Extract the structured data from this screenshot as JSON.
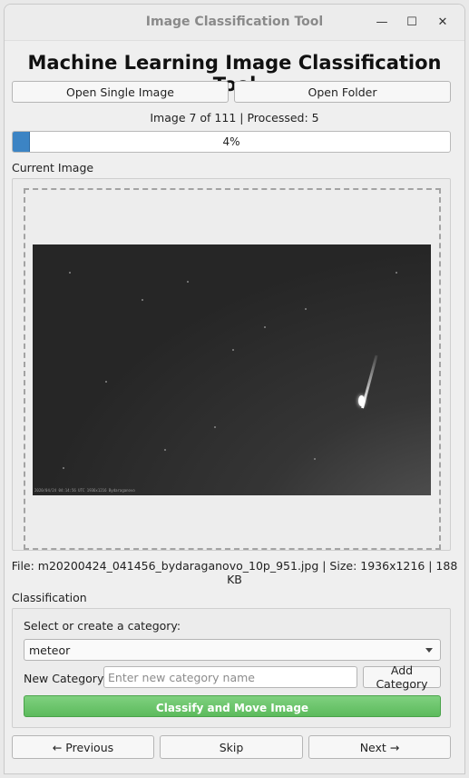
{
  "window": {
    "title": "Image Classification Tool",
    "minimize_glyph": "—",
    "maximize_glyph": "☐",
    "close_glyph": "✕"
  },
  "header": {
    "title": "Machine Learning Image Classification Tool"
  },
  "toolbar": {
    "open_single": "Open Single Image",
    "open_folder": "Open Folder"
  },
  "status": {
    "text": "Image 7 of 111 | Processed: 5"
  },
  "progress": {
    "percent": 4,
    "label": "4%",
    "color": "#3c84c4"
  },
  "current_image": {
    "section_label": "Current Image",
    "overlay_text": "2020/04/24 04:14:56 UTC 1936x1216 Bydaraganovo",
    "file_info": "File: m20200424_041456_bydaraganovo_10p_951.jpg | Size: 1936x1216 | 188 KB"
  },
  "classification": {
    "section_label": "Classification",
    "prompt": "Select or create a category:",
    "selected_category": "meteor",
    "new_category_label": "New Category:",
    "new_category_placeholder": "Enter new category name",
    "add_button": "Add Category",
    "classify_button": "Classify and Move Image",
    "classify_color": "#5cbb5c"
  },
  "nav": {
    "previous": "← Previous",
    "skip": "Skip",
    "next": "Next →"
  }
}
